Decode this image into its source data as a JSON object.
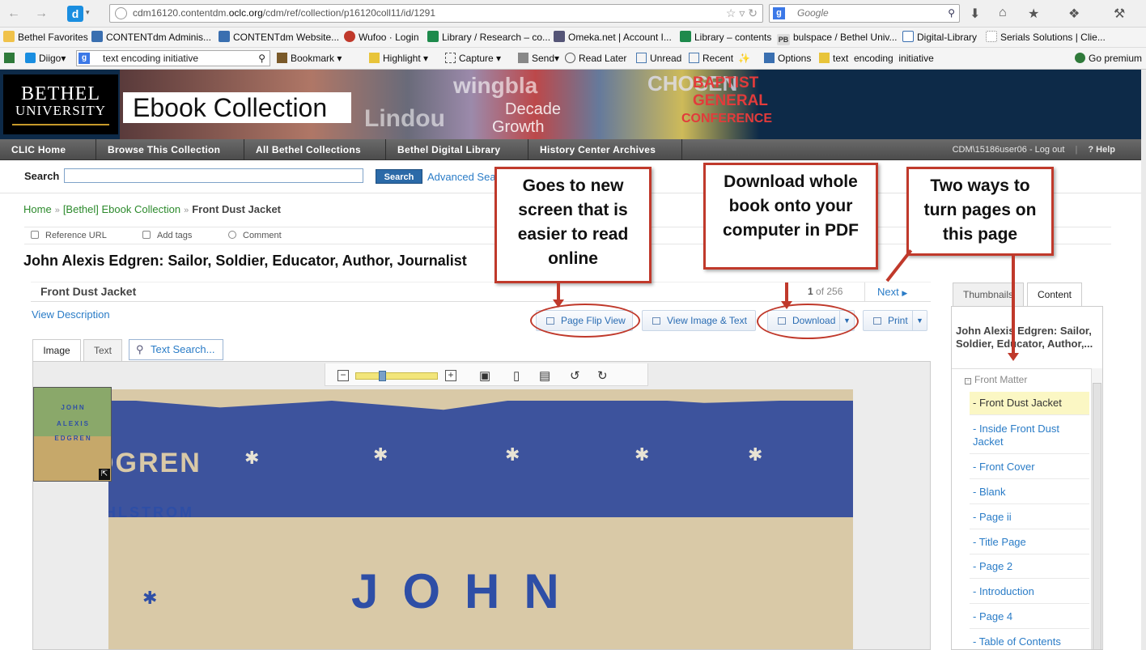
{
  "browser": {
    "url_host": "cdm16120.contentdm.",
    "url_domain": "oclc.org",
    "url_path": "/cdm/ref/collection/p16120coll11/id/1291",
    "search_placeholder": "Google",
    "bookmarks": [
      "Bethel Favorites",
      "CONTENTdm Adminis...",
      "CONTENTdm Website...",
      "Wufoo · Login",
      "Library / Research – co...",
      "Omeka.net | Account I...",
      "Library – contents",
      "bulspace / Bethel Univ...",
      "Digital-Library",
      "Serials Solutions | Clie..."
    ],
    "toolbar": {
      "diigo": "Diigo",
      "search_value": "text encoding initiative",
      "bookmark": "Bookmark",
      "highlight": "Highlight",
      "capture": "Capture",
      "send": "Send",
      "read_later": "Read Later",
      "unread": "Unread",
      "recent": "Recent",
      "options": "Options",
      "highlight_terms": "text  encoding  initiative",
      "premium": "Go premium"
    }
  },
  "banner": {
    "logo_line1": "BETHEL",
    "logo_line2": "UNIVERSITY",
    "title": "Ebook Collection",
    "collage_words": [
      "wingbla",
      "CHOSEN",
      "Decade",
      "Growth",
      "BAPTIST",
      "GENERAL",
      "CONFERENCE",
      "Lindou"
    ]
  },
  "nav": {
    "items": [
      "CLIC Home",
      "Browse This Collection",
      "All Bethel Collections",
      "Bethel Digital Library",
      "History Center Archives"
    ],
    "user": "CDM\\15186user06 - Log out",
    "help": "? Help"
  },
  "search": {
    "label": "Search",
    "button": "Search",
    "advanced": "Advanced Sea"
  },
  "breadcrumb": [
    "Home",
    "[Bethel] Ebook Collection",
    "Front Dust Jacket"
  ],
  "item_tools": [
    "Reference URL",
    "Add tags",
    "Comment"
  ],
  "item_title": "John Alexis Edgren: Sailor, Soldier, Educator, Author, Journalist",
  "pager": {
    "page_title": "Front Dust Jacket",
    "current": "1",
    "of_label": "of 256",
    "next": "Next"
  },
  "view_description": "View Description",
  "actions": {
    "page_flip": "Page Flip View",
    "view_image_text": "View Image & Text",
    "download": "Download",
    "print": "Print"
  },
  "viewer_tabs": {
    "image": "Image",
    "text": "Text",
    "text_search": "Text Search..."
  },
  "viewer": {
    "zoom_level": 0.3,
    "cover_text": "JOHN",
    "cover_author": "AHLSTROM",
    "cover_partial": "DGREN",
    "thumb_lines": [
      "JOHN",
      "ALEXIS",
      "EDGREN"
    ]
  },
  "right_panel": {
    "tabs": [
      "Thumbnails",
      "Content"
    ],
    "title": "John Alexis Edgren: Sailor, Soldier, Educator, Author,...",
    "section": "Front Matter",
    "items": [
      "- Front Dust Jacket",
      "- Inside Front Dust Jacket",
      "- Front Cover",
      "- Blank",
      "- Page ii",
      "- Title Page",
      "- Page 2",
      "- Introduction",
      "- Page 4",
      "- Table of Contents"
    ],
    "selected_index": 0
  },
  "callouts": {
    "flip": "Goes to new screen that is easier to read online",
    "download": "Download whole book onto your computer in PDF",
    "pages": "Two ways to turn pages on this page"
  },
  "colors": {
    "annotation": "#c0392b",
    "link": "#2a7cc7",
    "nav_bg": "#555555",
    "banner_bg": "#0d2a48"
  }
}
